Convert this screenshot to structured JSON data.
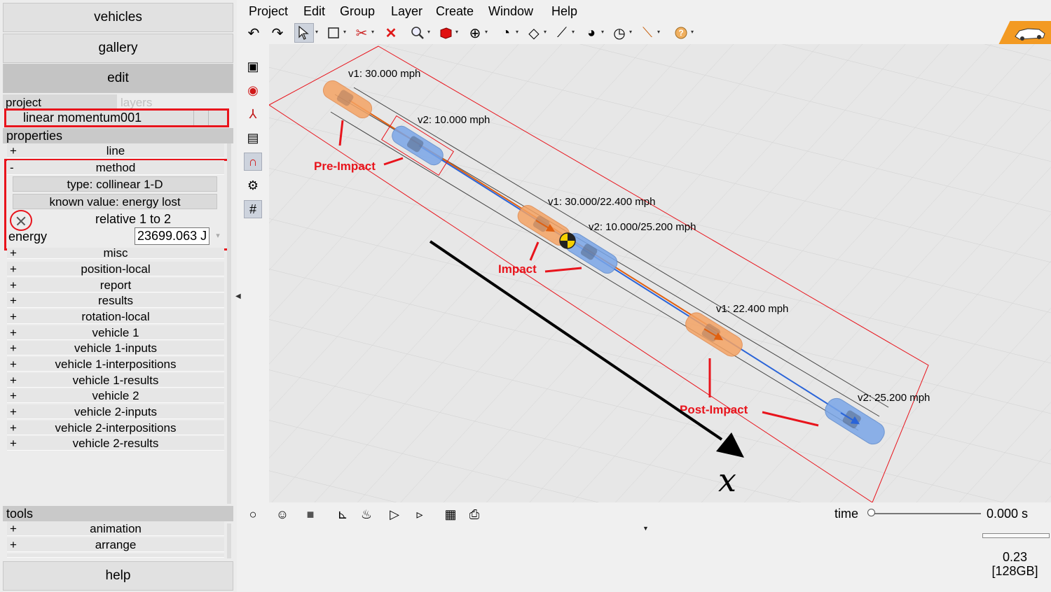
{
  "nav": {
    "vehicles": "vehicles",
    "gallery": "gallery",
    "edit": "edit",
    "help": "help"
  },
  "tabs": {
    "project": "project",
    "layers": "layers"
  },
  "project_item": "linear momentum001",
  "properties_header": "properties",
  "props": {
    "line": "line",
    "method": "method",
    "method_type": "type: collinear 1-D",
    "method_known": "known value: energy lost",
    "method_relative": "relative 1 to 2",
    "energy_label": "energy",
    "energy_value": "23699.063 J",
    "misc": "misc",
    "list": [
      "position-local",
      "report",
      "results",
      "rotation-local",
      "vehicle 1",
      "vehicle 1-inputs",
      "vehicle 1-interpositions",
      "vehicle 1-results",
      "vehicle 2",
      "vehicle 2-inputs",
      "vehicle 2-interpositions",
      "vehicle 2-results"
    ]
  },
  "plus": "+",
  "minus": "-",
  "tools_header": "tools",
  "tools": [
    "animation",
    "arrange"
  ],
  "menu": [
    "Project",
    "Edit",
    "Group",
    "Layer",
    "Create",
    "Window",
    "Help"
  ],
  "scene": {
    "pre_v1": "v1: 30.000 mph",
    "pre_v2": "v2: 10.000 mph",
    "imp_v1": "v1: 30.000/22.400 mph",
    "imp_v2": "v2: 10.000/25.200 mph",
    "post_v1": "v1: 22.400 mph",
    "post_v2": "v2: 25.200 mph",
    "annot_pre": "Pre-Impact",
    "annot_impact": "Impact",
    "annot_post": "Post-Impact",
    "axis_label": "x"
  },
  "time": {
    "label": "time",
    "value": "0.000 s"
  },
  "version": {
    "line1": "0.23",
    "line2": "[128GB]"
  },
  "colors": {
    "annotation": "#e8141c",
    "vehicle1": "#f4a364",
    "vehicle2": "#7aa6e8",
    "accent": "#f39a22"
  }
}
